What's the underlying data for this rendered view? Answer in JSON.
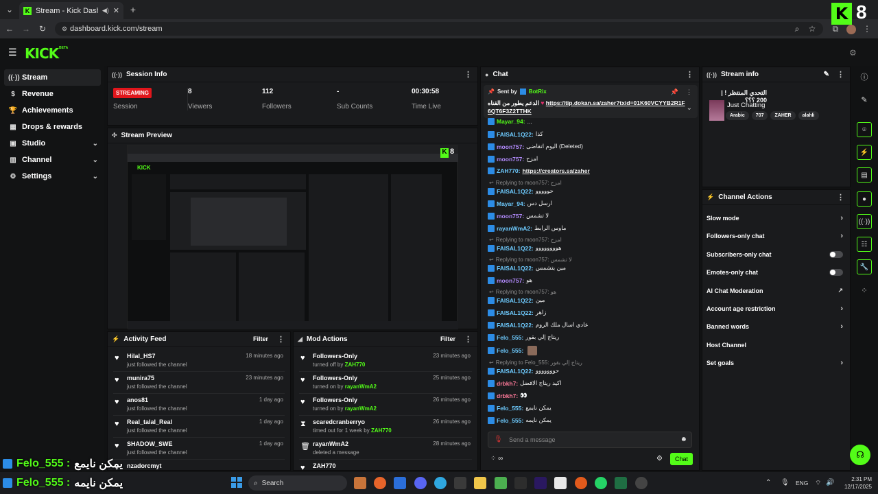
{
  "browser": {
    "tab_title": "Stream - Kick Dashboard",
    "url": "dashboard.kick.com/stream",
    "new_tab": "+"
  },
  "app": {
    "logo": "KICK",
    "beta": "BETA"
  },
  "sidebar": {
    "items": [
      {
        "label": "Stream",
        "icon": "broadcast-icon",
        "active": true,
        "chev": false
      },
      {
        "label": "Revenue",
        "icon": "dollar-icon",
        "chev": false
      },
      {
        "label": "Achievements",
        "icon": "trophy-icon",
        "chev": false
      },
      {
        "label": "Drops & rewards",
        "icon": "gift-icon",
        "chev": false
      },
      {
        "label": "Studio",
        "icon": "studio-icon",
        "chev": true
      },
      {
        "label": "Channel",
        "icon": "channel-icon",
        "chev": true
      },
      {
        "label": "Settings",
        "icon": "gear-icon",
        "chev": true
      }
    ]
  },
  "session": {
    "title": "Session Info",
    "badge": "STREAMING",
    "stats": [
      {
        "value": "",
        "label": "Session"
      },
      {
        "value": "8",
        "label": "Viewers"
      },
      {
        "value": "112",
        "label": "Followers"
      },
      {
        "value": "-",
        "label": "Sub Counts"
      },
      {
        "value": "00:30:58",
        "label": "Time Live"
      }
    ]
  },
  "preview": {
    "title": "Stream Preview",
    "viewer_count": "8"
  },
  "activity": {
    "title": "Activity Feed",
    "filter": "Filter",
    "rows": [
      {
        "name": "Hilal_HS7",
        "sub": "just followed the channel",
        "time": "18 minutes ago"
      },
      {
        "name": "munira75",
        "sub": "just followed the channel",
        "time": "23 minutes ago"
      },
      {
        "name": "anos81",
        "sub": "just followed the channel",
        "time": "1 day ago"
      },
      {
        "name": "Real_talal_Real",
        "sub": "just followed the channel",
        "time": "1 day ago"
      },
      {
        "name": "SHADOW_SWE",
        "sub": "just followed the channel",
        "time": "1 day ago"
      },
      {
        "name": "nzadorcmyt",
        "sub": "",
        "time": ""
      }
    ]
  },
  "mod": {
    "title": "Mod Actions",
    "filter": "Filter",
    "rows": [
      {
        "name": "Followers-Only",
        "pre": "turned off by",
        "by": "ZAH770",
        "time": "23 minutes ago",
        "icon": "heart"
      },
      {
        "name": "Followers-Only",
        "pre": "turned on by",
        "by": "rayanWmA2",
        "time": "25 minutes ago",
        "icon": "heart"
      },
      {
        "name": "Followers-Only",
        "pre": "turned on by",
        "by": "rayanWmA2",
        "time": "26 minutes ago",
        "icon": "heart"
      },
      {
        "name": "scaredcranberryo",
        "pre": "timed out for 1 week by",
        "by": "ZAH770",
        "time": "26 minutes ago",
        "icon": "hourglass"
      },
      {
        "name": "rayanWmA2",
        "pre": "deleted a message",
        "by": "",
        "time": "28 minutes ago",
        "icon": "trash"
      },
      {
        "name": "ZAH770",
        "pre": "",
        "by": "",
        "time": "",
        "icon": "heart"
      }
    ]
  },
  "chat": {
    "title": "Chat",
    "pinned_sender_label": "Sent by",
    "pinned_sender": "BotRix",
    "pinned_text": "الدعم يطور من القناه",
    "pinned_link": "https://tip.dokan.sa/zaher?txid=01K60VCYYB2R1F6QT6F3Z2TTHK",
    "messages": [
      {
        "user": "Mayar_94:",
        "text": "...",
        "color": "#53fc18",
        "reply": ""
      },
      {
        "user": "FAISAL1Q22:",
        "text": "كذا",
        "color": "#6ecbff",
        "reply": ""
      },
      {
        "user": "moon757:",
        "text": "اليوم اتقاضى (Deleted)",
        "color": "#b48cff",
        "reply": ""
      },
      {
        "user": "moon757:",
        "text": "امزح",
        "color": "#b48cff",
        "reply": ""
      },
      {
        "user": "ZAH770:",
        "text": "https://creators.sa/zaher",
        "color": "#6ecbff",
        "reply": ""
      },
      {
        "user": "FAISAL1Q22:",
        "text": "حووووو",
        "color": "#6ecbff",
        "reply": "Replying to moon757: امزح"
      },
      {
        "user": "Mayar_94:",
        "text": "ارسل دس",
        "color": "#6ecbff",
        "reply": ""
      },
      {
        "user": "moon757:",
        "text": "لا تشمس",
        "color": "#b48cff",
        "reply": ""
      },
      {
        "user": "rayanWmA2:",
        "text": "ماوس الرابط",
        "color": "#6ecbff",
        "reply": ""
      },
      {
        "user": "FAISAL1Q22:",
        "text": "هوووووووو",
        "color": "#6ecbff",
        "reply": "Replying to moon757: امزح"
      },
      {
        "user": "FAISAL1Q22:",
        "text": "مين يتشمس",
        "color": "#6ecbff",
        "reply": "Replying to moon757: لا تشمس"
      },
      {
        "user": "moon757:",
        "text": "هو",
        "color": "#b48cff",
        "reply": ""
      },
      {
        "user": "FAISAL1Q22:",
        "text": "مين",
        "color": "#6ecbff",
        "reply": "Replying to moon757: هو"
      },
      {
        "user": "FAISAL1Q22:",
        "text": "زاهر",
        "color": "#6ecbff",
        "reply": ""
      },
      {
        "user": "FAISAL1Q22:",
        "text": "عادي اسال ملك الروم",
        "color": "#6ecbff",
        "reply": ""
      },
      {
        "user": "Felo_555:",
        "text": "ريتاج إلي بقور",
        "color": "#6ecbff",
        "reply": ""
      },
      {
        "user": "Felo_555:",
        "text": "",
        "color": "#6ecbff",
        "reply": ""
      },
      {
        "user": "FAISAL1Q22:",
        "text": "حووووووو",
        "color": "#6ecbff",
        "reply": "Replying to Felo_555: ريتاج إلي بقور"
      },
      {
        "user": "drbkh7:",
        "text": "اكيد ريتاج الافضل",
        "color": "#ff7a9a",
        "reply": ""
      },
      {
        "user": "drbkh7:",
        "text": "👀",
        "color": "#ff7a9a",
        "reply": ""
      },
      {
        "user": "Felo_555:",
        "text": "يمكن نايمع",
        "color": "#6ecbff",
        "reply": ""
      },
      {
        "user": "Felo_555:",
        "text": "يمكن نايمه",
        "color": "#6ecbff",
        "reply": ""
      }
    ],
    "input_placeholder": "Send a message",
    "send": "Chat"
  },
  "streaminfo": {
    "title": "Stream info",
    "stream_title": "التحدي المنتظر ! | 200 ؟؟؟",
    "category": "Just Chatting",
    "tags": [
      "Arabic",
      "707",
      "ZAHER",
      "alahli"
    ]
  },
  "actions": {
    "title": "Channel Actions",
    "items": [
      {
        "label": "Slow mode",
        "type": "arrow"
      },
      {
        "label": "Followers-only chat",
        "type": "arrow"
      },
      {
        "label": "Subscribers-only chat",
        "type": "toggle"
      },
      {
        "label": "Emotes-only chat",
        "type": "toggle"
      },
      {
        "label": "AI Chat Moderation",
        "type": "external"
      },
      {
        "label": "Account age restriction",
        "type": "arrow"
      },
      {
        "label": "Banned words",
        "type": "arrow"
      },
      {
        "label": "Host Channel",
        "type": "none"
      },
      {
        "label": "Set goals",
        "type": "arrow"
      }
    ]
  },
  "overlay": {
    "line1_user": "Felo_555 :",
    "line1_text": "يمكن نايمع",
    "line2_user": "Felo_555 :",
    "line2_text": "يمكن نايمه"
  },
  "taskbar": {
    "search": "Search",
    "lang": "ENG",
    "time": "2:31 PM",
    "date": "12/17/2025"
  },
  "colors": {
    "accent": "#53fc18",
    "live": "#e1161c"
  }
}
